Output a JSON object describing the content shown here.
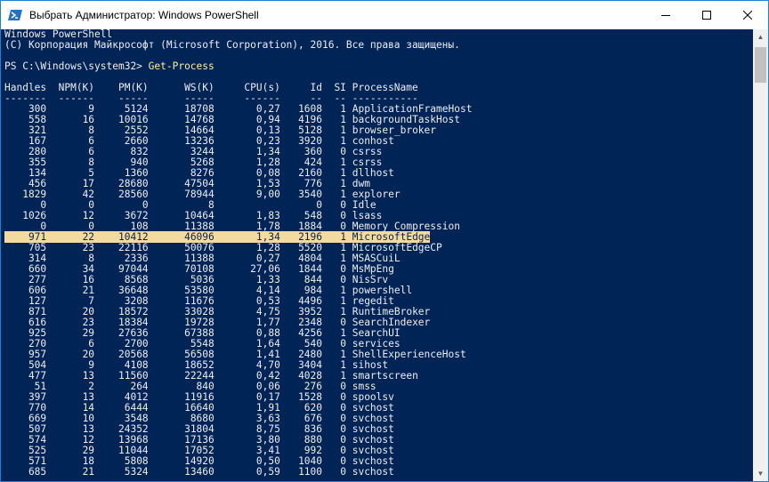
{
  "window": {
    "title": "Выбрать Администратор: Windows PowerShell",
    "icon": "powershell-icon",
    "controls": {
      "minimize": "minimize-icon",
      "maximize": "maximize-icon",
      "close": "close-icon"
    }
  },
  "colors": {
    "console_bg": "#012456",
    "text": "#eeedf0",
    "command": "#f9f1a5",
    "highlight": "#f3da9f"
  },
  "console": {
    "banner1": "Windows PowerShell",
    "banner2": "(C) Корпорация Майкрософт (Microsoft Corporation), 2016. Все права защищены.",
    "prompt": "PS C:\\Windows\\system32> ",
    "command": "Get-Process",
    "header": "Handles  NPM(K)    PM(K)      WS(K)     CPU(s)     Id  SI ProcessName",
    "separator": "-------  ------    -----      -----     ------     --  -- -----------",
    "rows": [
      {
        "handles": "300",
        "npm": "9",
        "pm": "5124",
        "ws": "18708",
        "cpu": "0,27",
        "id": "1608",
        "si": "1",
        "name": "ApplicationFrameHost"
      },
      {
        "handles": "558",
        "npm": "16",
        "pm": "10016",
        "ws": "14768",
        "cpu": "0,94",
        "id": "4196",
        "si": "1",
        "name": "backgroundTaskHost"
      },
      {
        "handles": "321",
        "npm": "8",
        "pm": "2552",
        "ws": "14664",
        "cpu": "0,13",
        "id": "5128",
        "si": "1",
        "name": "browser_broker"
      },
      {
        "handles": "167",
        "npm": "6",
        "pm": "2660",
        "ws": "13236",
        "cpu": "0,23",
        "id": "3920",
        "si": "1",
        "name": "conhost"
      },
      {
        "handles": "280",
        "npm": "6",
        "pm": "832",
        "ws": "3244",
        "cpu": "1,34",
        "id": "360",
        "si": "0",
        "name": "csrss"
      },
      {
        "handles": "355",
        "npm": "8",
        "pm": "940",
        "ws": "5268",
        "cpu": "1,28",
        "id": "424",
        "si": "1",
        "name": "csrss"
      },
      {
        "handles": "134",
        "npm": "5",
        "pm": "1360",
        "ws": "8276",
        "cpu": "0,08",
        "id": "2160",
        "si": "1",
        "name": "dllhost"
      },
      {
        "handles": "456",
        "npm": "17",
        "pm": "28680",
        "ws": "47504",
        "cpu": "1,53",
        "id": "776",
        "si": "1",
        "name": "dwm"
      },
      {
        "handles": "1829",
        "npm": "42",
        "pm": "28560",
        "ws": "78944",
        "cpu": "9,00",
        "id": "3540",
        "si": "1",
        "name": "explorer"
      },
      {
        "handles": "0",
        "npm": "0",
        "pm": "0",
        "ws": "8",
        "cpu": "",
        "id": "0",
        "si": "0",
        "name": "Idle"
      },
      {
        "handles": "1026",
        "npm": "12",
        "pm": "3672",
        "ws": "10464",
        "cpu": "1,83",
        "id": "548",
        "si": "0",
        "name": "lsass"
      },
      {
        "handles": "0",
        "npm": "0",
        "pm": "108",
        "ws": "11388",
        "cpu": "1,78",
        "id": "1884",
        "si": "0",
        "name": "Memory Compression"
      },
      {
        "handles": "971",
        "npm": "22",
        "pm": "10412",
        "ws": "46096",
        "cpu": "1,34",
        "id": "2196",
        "si": "1",
        "name": "MicrosoftEdge"
      },
      {
        "handles": "705",
        "npm": "23",
        "pm": "22116",
        "ws": "50076",
        "cpu": "1,28",
        "id": "5520",
        "si": "1",
        "name": "MicrosoftEdgeCP"
      },
      {
        "handles": "314",
        "npm": "8",
        "pm": "2336",
        "ws": "11388",
        "cpu": "0,27",
        "id": "4804",
        "si": "1",
        "name": "MSASCuiL"
      },
      {
        "handles": "660",
        "npm": "34",
        "pm": "97044",
        "ws": "70108",
        "cpu": "27,06",
        "id": "1844",
        "si": "0",
        "name": "MsMpEng"
      },
      {
        "handles": "277",
        "npm": "16",
        "pm": "8568",
        "ws": "5036",
        "cpu": "1,33",
        "id": "844",
        "si": "0",
        "name": "NisSrv"
      },
      {
        "handles": "606",
        "npm": "21",
        "pm": "36648",
        "ws": "53580",
        "cpu": "4,14",
        "id": "984",
        "si": "1",
        "name": "powershell"
      },
      {
        "handles": "127",
        "npm": "7",
        "pm": "3208",
        "ws": "11676",
        "cpu": "0,53",
        "id": "4496",
        "si": "1",
        "name": "regedit"
      },
      {
        "handles": "871",
        "npm": "20",
        "pm": "18572",
        "ws": "33028",
        "cpu": "4,75",
        "id": "3952",
        "si": "1",
        "name": "RuntimeBroker"
      },
      {
        "handles": "616",
        "npm": "23",
        "pm": "18384",
        "ws": "19728",
        "cpu": "1,77",
        "id": "2348",
        "si": "0",
        "name": "SearchIndexer"
      },
      {
        "handles": "925",
        "npm": "29",
        "pm": "27636",
        "ws": "67388",
        "cpu": "0,88",
        "id": "4256",
        "si": "1",
        "name": "SearchUI"
      },
      {
        "handles": "270",
        "npm": "6",
        "pm": "2700",
        "ws": "5548",
        "cpu": "1,64",
        "id": "540",
        "si": "0",
        "name": "services"
      },
      {
        "handles": "957",
        "npm": "20",
        "pm": "20568",
        "ws": "56508",
        "cpu": "1,41",
        "id": "2480",
        "si": "1",
        "name": "ShellExperienceHost"
      },
      {
        "handles": "504",
        "npm": "9",
        "pm": "4108",
        "ws": "18652",
        "cpu": "4,70",
        "id": "3404",
        "si": "1",
        "name": "sihost"
      },
      {
        "handles": "477",
        "npm": "13",
        "pm": "11560",
        "ws": "22244",
        "cpu": "0,42",
        "id": "4028",
        "si": "1",
        "name": "smartscreen"
      },
      {
        "handles": "51",
        "npm": "2",
        "pm": "264",
        "ws": "840",
        "cpu": "0,06",
        "id": "276",
        "si": "0",
        "name": "smss"
      },
      {
        "handles": "397",
        "npm": "13",
        "pm": "4012",
        "ws": "11916",
        "cpu": "0,17",
        "id": "1528",
        "si": "0",
        "name": "spoolsv"
      },
      {
        "handles": "770",
        "npm": "14",
        "pm": "6444",
        "ws": "16640",
        "cpu": "1,91",
        "id": "620",
        "si": "0",
        "name": "svchost"
      },
      {
        "handles": "669",
        "npm": "10",
        "pm": "3548",
        "ws": "8680",
        "cpu": "3,63",
        "id": "676",
        "si": "0",
        "name": "svchost"
      },
      {
        "handles": "507",
        "npm": "13",
        "pm": "24352",
        "ws": "31804",
        "cpu": "8,75",
        "id": "836",
        "si": "0",
        "name": "svchost"
      },
      {
        "handles": "574",
        "npm": "12",
        "pm": "13968",
        "ws": "17136",
        "cpu": "3,80",
        "id": "880",
        "si": "0",
        "name": "svchost"
      },
      {
        "handles": "525",
        "npm": "29",
        "pm": "11044",
        "ws": "17052",
        "cpu": "3,41",
        "id": "992",
        "si": "0",
        "name": "svchost"
      },
      {
        "handles": "571",
        "npm": "18",
        "pm": "5808",
        "ws": "14920",
        "cpu": "0,50",
        "id": "1040",
        "si": "0",
        "name": "svchost"
      },
      {
        "handles": "685",
        "npm": "21",
        "pm": "5324",
        "ws": "13460",
        "cpu": "0,59",
        "id": "1100",
        "si": "0",
        "name": "svchost"
      }
    ],
    "highlighted_row": 12
  }
}
